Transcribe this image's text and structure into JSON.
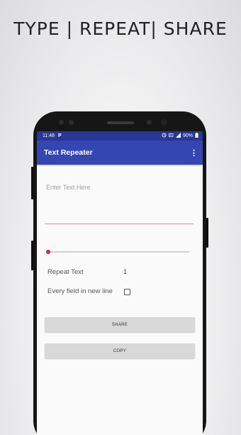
{
  "headline": "TYPE | REPEAT| SHARE",
  "status_bar": {
    "time": "11:48",
    "notification_icon": "P",
    "battery": "90%"
  },
  "app_bar": {
    "title": "Text Repeater",
    "overflow_icon": "⋮"
  },
  "text_input": {
    "placeholder": "Enter Text Here",
    "value": ""
  },
  "slider": {
    "value": 0
  },
  "repeat_row": {
    "label": "Repeat Text",
    "count": "1"
  },
  "newline_row": {
    "label": "Every field in new line",
    "checked": false
  },
  "buttons": {
    "share": "SHARE",
    "copy": "COPY"
  },
  "colors": {
    "app_bar": "#3346b1",
    "status_bar": "#293795",
    "accent": "#e5195c",
    "underline": "#e8859b"
  }
}
